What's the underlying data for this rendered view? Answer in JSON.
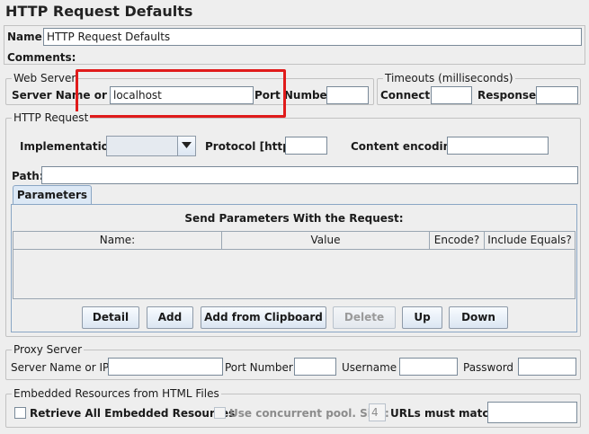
{
  "title": "HTTP Request Defaults",
  "name_label": "Name:",
  "name_value": "HTTP Request Defaults",
  "comments_label": "Comments:",
  "web_server": {
    "legend": "Web Server",
    "server_label": "Server Name or IP:",
    "server_value": "localhost",
    "port_label": "Port Number:",
    "port_value": ""
  },
  "timeouts": {
    "legend": "Timeouts (milliseconds)",
    "connect_label": "Connect:",
    "connect_value": "",
    "response_label": "Response:",
    "response_value": ""
  },
  "http_request": {
    "legend": "HTTP Request",
    "implementation_label": "Implementation:",
    "implementation_value": "",
    "protocol_label": "Protocol [http]:",
    "protocol_value": "",
    "encoding_label": "Content encoding:",
    "encoding_value": "",
    "path_label": "Path:",
    "path_value": ""
  },
  "parameters": {
    "tab_label": "Parameters",
    "heading": "Send Parameters With the Request:",
    "columns": [
      "Name:",
      "Value",
      "Encode?",
      "Include Equals?"
    ],
    "buttons": {
      "detail": "Detail",
      "add": "Add",
      "add_clipboard": "Add from Clipboard",
      "delete": "Delete",
      "up": "Up",
      "down": "Down"
    }
  },
  "proxy": {
    "legend": "Proxy Server",
    "server_label": "Server Name or IP:",
    "server_value": "",
    "port_label": "Port Number:",
    "port_value": "",
    "username_label": "Username",
    "username_value": "",
    "password_label": "Password",
    "password_value": ""
  },
  "embedded": {
    "legend": "Embedded Resources from HTML Files",
    "retrieve_label": "Retrieve All Embedded Resources",
    "concurrent_label": "Use concurrent pool. Size:",
    "pool_size": "4",
    "urls_label": "URLs must match:",
    "urls_value": ""
  },
  "colors": {
    "highlight": "#e01b1b",
    "tab": "#dce8f5",
    "background": "#eeeeee"
  }
}
